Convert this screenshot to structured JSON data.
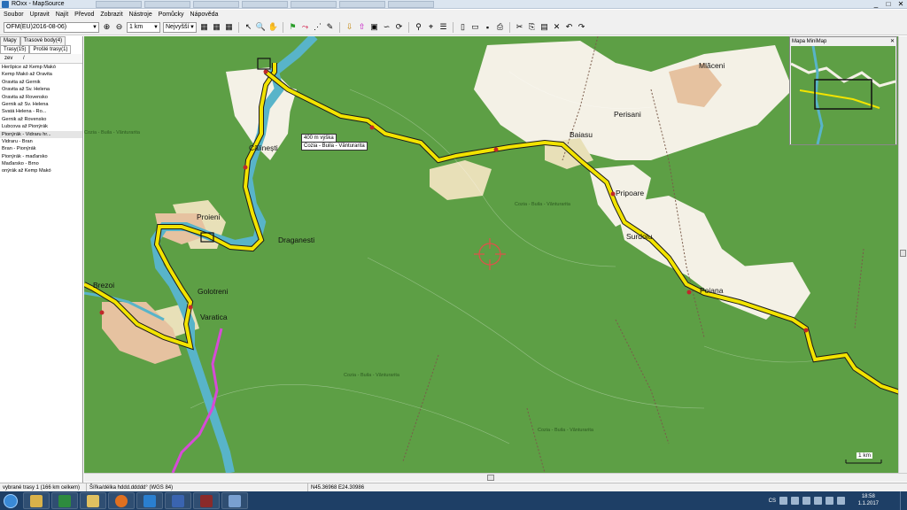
{
  "window": {
    "title": "ROxx - MapSource",
    "buttons": [
      "_",
      "□",
      "✕"
    ]
  },
  "menu": [
    "Soubor",
    "Upravit",
    "Najít",
    "Převod",
    "Zobrazit",
    "Nástroje",
    "Pomůcky",
    "Nápověda"
  ],
  "toolbar": {
    "map_product": "OFM(EU)2016-08-06)",
    "zoom_scale": "1 km",
    "detail_level": "Nejvyšší"
  },
  "left_panel": {
    "tabs_top": [
      "Mapy",
      "Trasové body(4)"
    ],
    "tabs_bottom": [
      "Trasy(15)",
      "Prošlé trasy(1)"
    ],
    "list_header": "zev",
    "routes": [
      "Heršpice až Kemp Makó",
      "Kemp Makó až Oravita",
      "Oravita až Gernik",
      "Oravita až Sv. Helena",
      "Oravita až Rovensko",
      "Gernik až Sv. Helena",
      "Svatá Helena - Ro...",
      "Gernik až Rovensko",
      "Lubcova až Pionýrák",
      "Pionýrák - Vidraru hr...",
      "Vidraru - Bran",
      "Bran - Pionýrák",
      "Pionýrák - maďarsko",
      "Maďarsko - Brno",
      "onýrák až Kemp Makó"
    ],
    "selected_index": 9
  },
  "map": {
    "tooltip_title": "400 m výška",
    "tooltip_name": "Cozia - Buila - Vânturarita",
    "scale_label": "1 km",
    "towns": {
      "mlaceni": "Mlăceni",
      "perisani": "Perisani",
      "baiasu": "Baiasu",
      "pripoare": "Pripoare",
      "surdoiu": "Surdoiu",
      "poiana": "Poiana",
      "calinesti": "Călinești",
      "proieni": "Proieni",
      "draganesti": "Draganesti",
      "golotreni": "Golotreni",
      "varatica": "Varatica",
      "brezoi": "Brezoi"
    },
    "park_label": "Cozia - Buila - Vânturarita"
  },
  "minimap": {
    "title": "Mapa MiniMap"
  },
  "status": {
    "selection": "vybrané trasy 1 (166 km celkem)",
    "format": "Šířka/délka hddd.ddddd° (WGS 84)",
    "coords": "N45.36968 E24.30986"
  },
  "taskbar": {
    "lang": "CS",
    "time": "18:58",
    "date": "1.1.2017"
  },
  "colors": {
    "forest": "#5d9f45",
    "route": "#f2e300",
    "river": "#5ab5c8",
    "pink_road": "#d64bd6"
  }
}
